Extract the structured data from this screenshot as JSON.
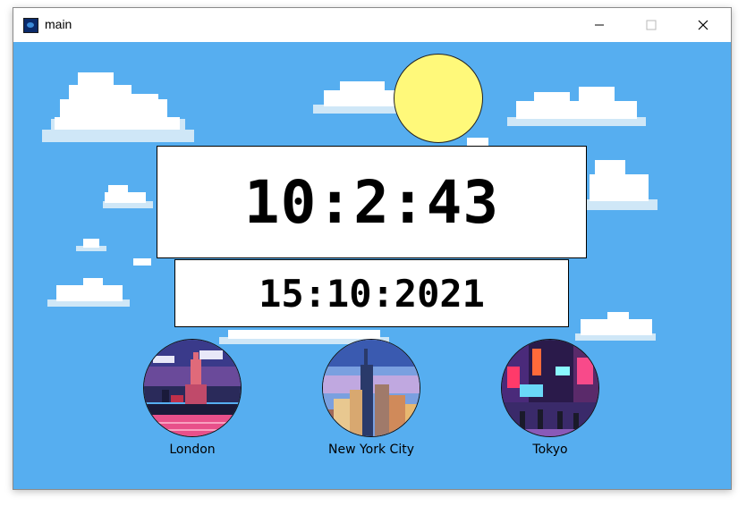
{
  "window": {
    "title": "main"
  },
  "clock": {
    "time": "10:2:43",
    "date": "15:10:2021"
  },
  "cities": [
    {
      "label": "London",
      "icon": "london-image"
    },
    {
      "label": "New York City",
      "icon": "new-york-image"
    },
    {
      "label": "Tokyo",
      "icon": "tokyo-image"
    }
  ],
  "colors": {
    "sky": "#56aef0",
    "sun": "#fff97a",
    "cloud": "#ffffff",
    "cloud_shade": "#cfe7f7"
  }
}
